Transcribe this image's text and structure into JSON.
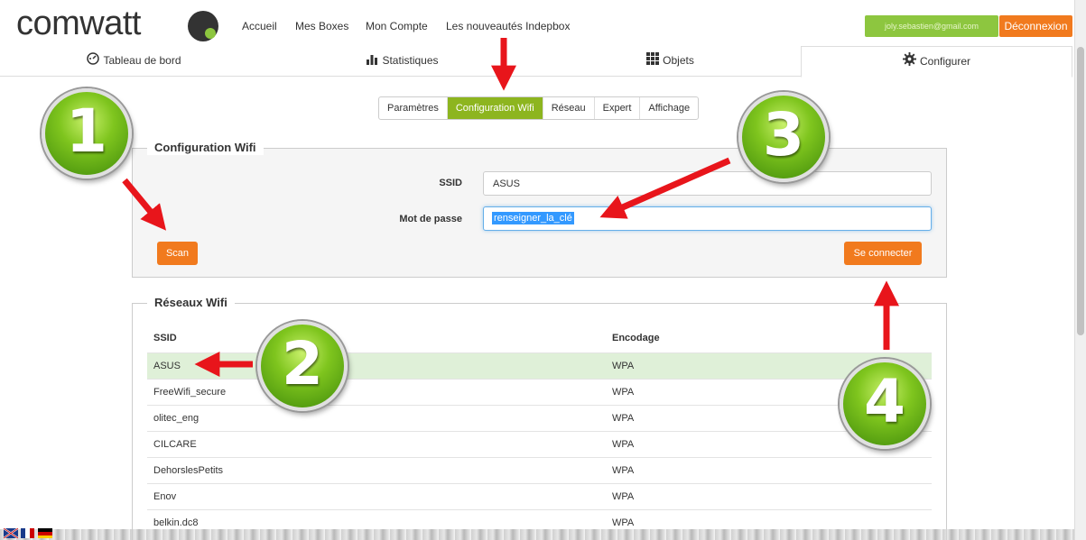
{
  "logo": {
    "text": "comwatt"
  },
  "topnav": [
    "Accueil",
    "Mes Boxes",
    "Mon Compte",
    "Les nouveautés Indepbox"
  ],
  "user": {
    "email": "joly.sebastien@gmail.com",
    "logout": "Déconnexion"
  },
  "main_tabs": [
    {
      "label": "Tableau de bord",
      "icon": "dashboard-icon"
    },
    {
      "label": "Statistiques",
      "icon": "bar-chart-icon"
    },
    {
      "label": "Objets",
      "icon": "grid-icon"
    },
    {
      "label": "Configurer",
      "icon": "gear-icon"
    }
  ],
  "sub_tabs": [
    "Paramètres",
    "Configuration Wifi",
    "Réseau",
    "Expert",
    "Affichage"
  ],
  "wifi_config": {
    "legend": "Configuration Wifi",
    "ssid_label": "SSID",
    "ssid_value": "ASUS",
    "password_label": "Mot de passe",
    "password_value": "renseigner_la_clé",
    "scan_label": "Scan",
    "connect_label": "Se connecter"
  },
  "networks": {
    "legend": "Réseaux Wifi",
    "headers": [
      "SSID",
      "Encodage"
    ],
    "rows": [
      {
        "ssid": "ASUS",
        "enc": "WPA"
      },
      {
        "ssid": "FreeWifi_secure",
        "enc": "WPA"
      },
      {
        "ssid": "olitec_eng",
        "enc": "WPA"
      },
      {
        "ssid": "CILCARE",
        "enc": "WPA"
      },
      {
        "ssid": "DehorslesPetits",
        "enc": "WPA"
      },
      {
        "ssid": "Enov",
        "enc": "WPA"
      },
      {
        "ssid": "belkin.dc8",
        "enc": "WPA"
      }
    ]
  },
  "badges": [
    "1",
    "2",
    "3",
    "4"
  ],
  "colors": {
    "accent_green": "#8db51f",
    "accent_orange": "#f17a1e",
    "arrow_red": "#e8151b"
  }
}
